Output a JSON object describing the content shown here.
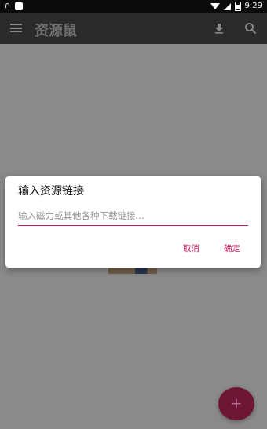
{
  "status_bar": {
    "time": "9:29",
    "left_icons": [
      "headset-icon",
      "notification-icon"
    ],
    "right_icons": [
      "wifi-icon",
      "signal-icon",
      "battery-icon"
    ]
  },
  "app_bar": {
    "title": "资源鼠",
    "icons": [
      "menu-icon",
      "download-icon",
      "search-icon"
    ]
  },
  "dialog": {
    "title": "输入资源链接",
    "input": {
      "value": "",
      "placeholder": "输入磁力或其他各种下载链接..."
    },
    "buttons": {
      "cancel_label": "取消",
      "ok_label": "确定"
    }
  },
  "fab": {
    "label": "+",
    "icon": "plus-icon"
  },
  "colors": {
    "accent": "#c2185b",
    "app_bar": "#2b2b2b",
    "status_bar": "#0b0b0b",
    "scrim": "#8a8a8a",
    "fab": "#6d1636"
  }
}
